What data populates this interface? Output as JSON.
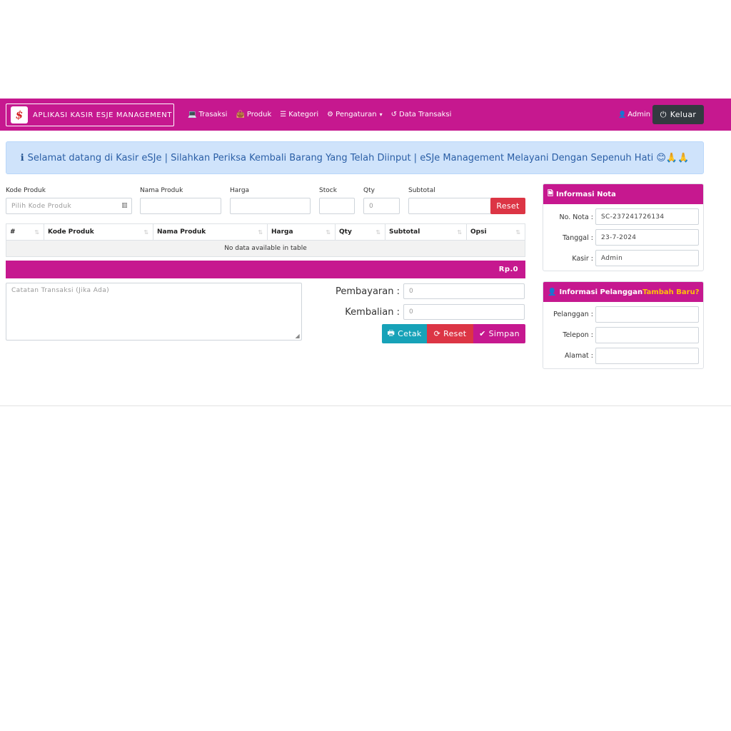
{
  "navbar": {
    "brand_logo": "$",
    "brand": "APLIKASI KASIR ESJE MANAGEMENT",
    "links": [
      {
        "icon": "laptop-icon",
        "glyph": "💻",
        "label": "Trasaksi"
      },
      {
        "icon": "shopping-bag-icon",
        "glyph": "👜",
        "label": "Produk"
      },
      {
        "icon": "list-icon",
        "glyph": "☰",
        "label": "Kategori"
      },
      {
        "icon": "cogs-icon",
        "glyph": "⚙",
        "label": "Pengaturan",
        "caret": "▾"
      },
      {
        "icon": "history-icon",
        "glyph": "↺",
        "label": "Data Transaksi"
      }
    ],
    "user_icon_glyph": "👤",
    "user": "Admin",
    "logout_glyph": "⏻",
    "logout": "Keluar"
  },
  "alert": {
    "icon_glyph": "ℹ",
    "text": "Selamat datang di Kasir eSJe | Silahkan Periksa Kembali Barang Yang Telah Diinput | eSJe Management Melayani Dengan Sepenuh Hati 😊🙏🙏"
  },
  "form": {
    "kode_label": "Kode Produk",
    "kode_placeholder": "Pilih Kode Produk",
    "barcode_glyph": "▥",
    "nama_label": "Nama Produk",
    "nama_value": "",
    "harga_label": "Harga",
    "harga_value": "",
    "stock_label": "Stock",
    "stock_value": "",
    "qty_label": "Qty",
    "qty_value": "0",
    "subtotal_label": "Subtotal",
    "subtotal_value": "",
    "reset_label": "Reset"
  },
  "table": {
    "sort_glyph": "⇅",
    "columns": [
      "#",
      "Kode Produk",
      "Nama Produk",
      "Harga",
      "Qty",
      "Subtotal",
      "Opsi"
    ],
    "empty": "No data available in table",
    "total": "Rp.0"
  },
  "notes": {
    "placeholder": "Catatan Transaksi (Jika Ada)",
    "resize_glyph": "◢"
  },
  "payment": {
    "bayar_label": "Pembayaran :",
    "bayar_value": "0",
    "kembali_label": "Kembalian :",
    "kembali_value": "0"
  },
  "actions": {
    "cetak_glyph": "🖶",
    "cetak": "Cetak",
    "reset_glyph": "⟳",
    "reset": "Reset",
    "simpan_glyph": "✔",
    "simpan": "Simpan"
  },
  "nota": {
    "title_glyph": "🗎",
    "title": "Informasi Nota",
    "no_label": "No. Nota :",
    "no_value": "SC-237241726134",
    "tanggal_label": "Tanggal :",
    "tanggal_value": "23-7-2024",
    "kasir_label": "Kasir :",
    "kasir_value": "Admin"
  },
  "pelanggan": {
    "title_glyph": "👤",
    "title": "Informasi Pelanggan",
    "add_link": "Tambah Baru?",
    "nama_label": "Pelanggan :",
    "telepon_label": "Telepon :",
    "alamat_label": "Alamat :"
  }
}
